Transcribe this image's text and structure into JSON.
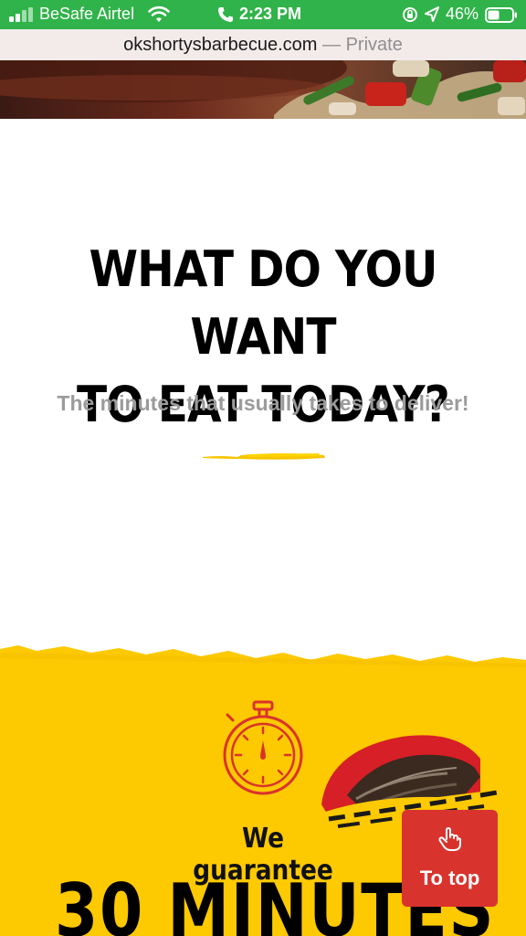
{
  "status_bar": {
    "carrier": "BeSafe Airtel",
    "time": "2:23 PM",
    "battery_percent": "46%",
    "icons": [
      "signal-icon",
      "wifi-icon",
      "phone-icon",
      "rotation-lock-icon",
      "location-icon",
      "battery-icon"
    ]
  },
  "browser": {
    "domain": "okshortysbarbecue.com",
    "mode": "— Private"
  },
  "hero": {
    "heading_line1": "WHAT DO YOU WANT",
    "heading_line2": "TO EAT TODAY?",
    "subtitle": "The minutes that usually takes to deliver!"
  },
  "promo": {
    "guarantee": "We guarantee",
    "minutes": "30 MINUTES",
    "icons": [
      "stopwatch-icon",
      "food-bowl-image"
    ]
  },
  "to_top": {
    "label": "To top",
    "icon": "hand-pointer-icon"
  },
  "colors": {
    "status_bar": "#30b34a",
    "url_bar": "#f3eaea",
    "accent_yellow": "#fdc900",
    "button_red": "#d9332d",
    "subtitle_gray": "#9b9b9b"
  }
}
